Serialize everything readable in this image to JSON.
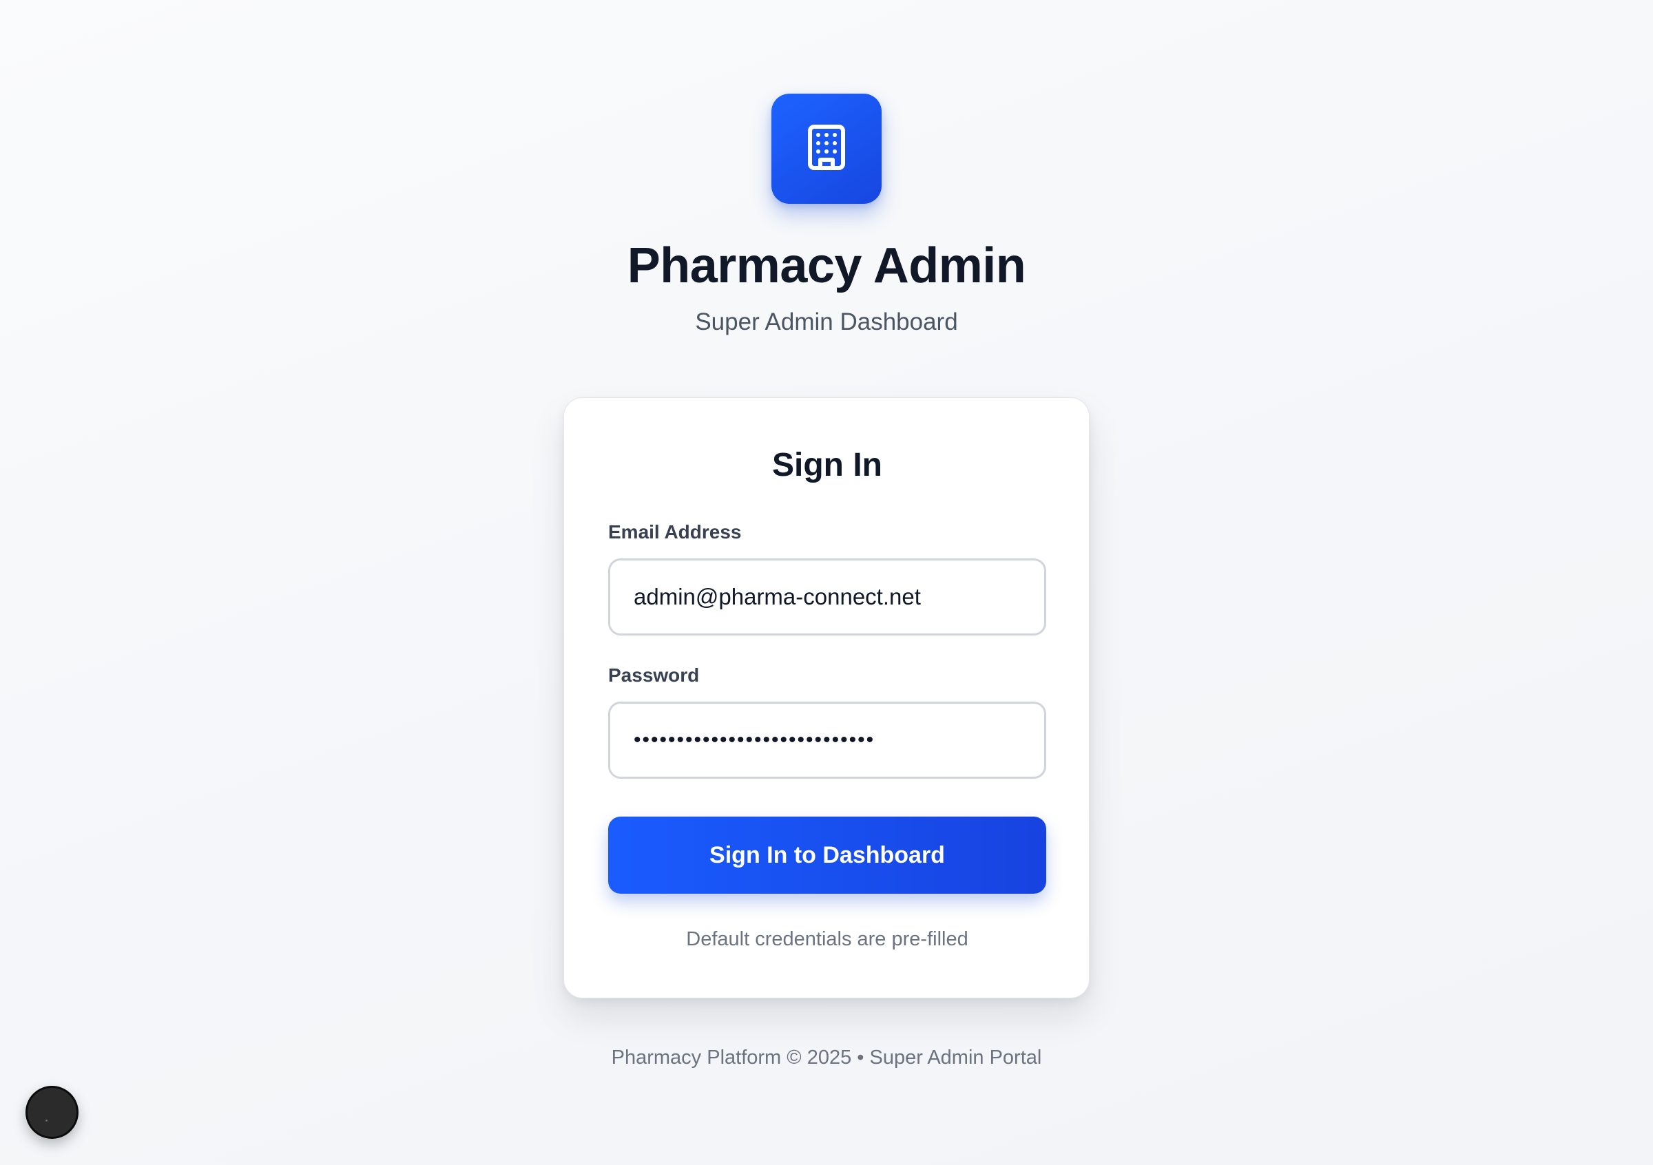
{
  "brand": {
    "logo_icon": "building-icon",
    "title": "Pharmacy Admin",
    "subtitle": "Super Admin Dashboard",
    "accent_color": "#1a5cff"
  },
  "login": {
    "heading": "Sign In",
    "email_label": "Email Address",
    "email_value": "admin@pharma-connect.net",
    "password_label": "Password",
    "password_value": "••••••••••••••••••••••••••••",
    "submit_label": "Sign In to Dashboard",
    "hint": "Default credentials are pre-filled"
  },
  "footer": {
    "text": "Pharmacy Platform © 2025 • Super Admin Portal"
  }
}
